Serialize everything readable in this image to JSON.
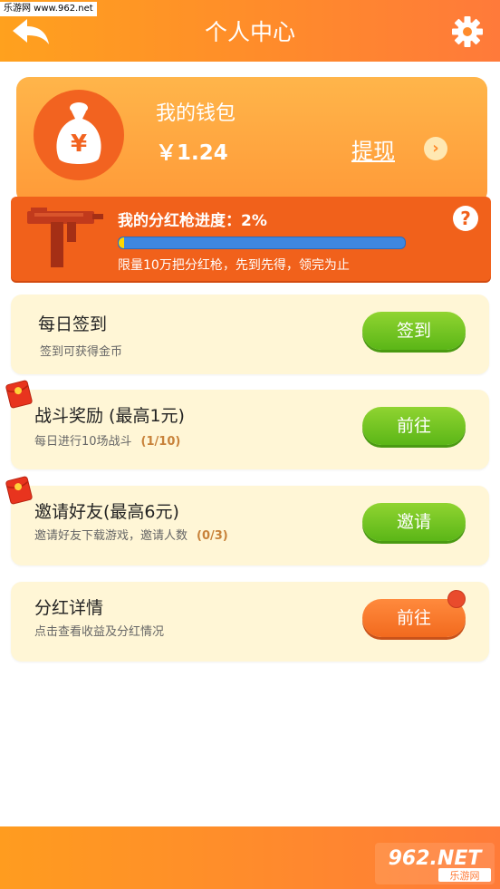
{
  "header": {
    "title": "个人中心",
    "watermark": "乐游网 www.962.net"
  },
  "wallet": {
    "title": "我的钱包",
    "balance": "￥1.24",
    "withdraw_label": "提现",
    "arrow": "›"
  },
  "gun": {
    "title": "我的分红枪进度：2%",
    "progress_percent": 2,
    "description": "限量10万把分红枪，先到先得，领完为止",
    "help": "?"
  },
  "tasks": [
    {
      "title": "每日签到",
      "desc": "签到可获得金币",
      "count": "",
      "button": "签到"
    },
    {
      "title": "战斗奖励 (最高1元)",
      "desc": "每日进行10场战斗",
      "count": "(1/10)",
      "button": "前往"
    },
    {
      "title": "邀请好友(最高6元)",
      "desc": "邀请好友下载游戏，邀请人数",
      "count": "(0/3)",
      "button": "邀请"
    },
    {
      "title": "分红详情",
      "desc": "点击查看收益及分红情况",
      "count": "",
      "button": "前往"
    }
  ],
  "footer": {
    "logo_text": "962.NET",
    "logo_sub": "乐游网"
  },
  "colors": {
    "header_orange": "#ff8b2b",
    "banner_orange": "#f1611b",
    "card_cream": "#fff6d6",
    "button_green": "#5bb617",
    "button_orange": "#f26a1e",
    "progress_blue": "#3f87e0",
    "progress_yellow": "#ffd800"
  },
  "icons": [
    "back-arrow-icon",
    "gear-icon",
    "moneybag-icon",
    "gun-icon",
    "help-icon",
    "red-envelope-icon"
  ]
}
